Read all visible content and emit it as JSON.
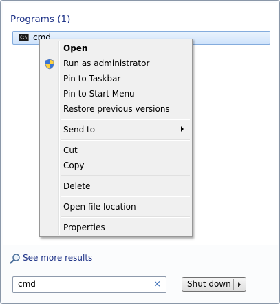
{
  "results": {
    "group_header": "Programs (1)",
    "items": [
      {
        "label": "cmd",
        "icon": "command-prompt-icon"
      }
    ]
  },
  "context_menu": {
    "items": {
      "open": "Open",
      "run_as_admin": "Run as administrator",
      "pin_taskbar": "Pin to Taskbar",
      "pin_start": "Pin to Start Menu",
      "restore": "Restore previous versions",
      "send_to": "Send to",
      "cut": "Cut",
      "copy": "Copy",
      "delete": "Delete",
      "open_location": "Open file location",
      "properties": "Properties"
    },
    "icon_shield": "uac-shield-icon",
    "icon_submenu": "chevron-right-icon"
  },
  "see_more": "See more results",
  "search": {
    "value": "cmd",
    "clear_icon": "×"
  },
  "shutdown": {
    "label": "Shut down"
  },
  "colors": {
    "header_text": "#1e3287",
    "selection": "#cfe3fb",
    "menu_bg": "#f0f0f0"
  }
}
